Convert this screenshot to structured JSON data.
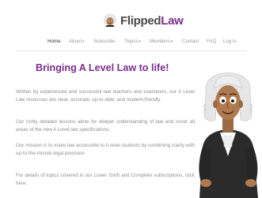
{
  "brand": {
    "name_part1": "Flipped",
    "name_part2": "Law",
    "icon": "lawyer-avatar-icon"
  },
  "nav": {
    "items": [
      {
        "label": "Home",
        "dropdown": false,
        "active": true
      },
      {
        "label": "About",
        "dropdown": true,
        "active": false
      },
      {
        "label": "Subscribe",
        "dropdown": false,
        "active": false
      },
      {
        "label": "Topics",
        "dropdown": true,
        "active": false
      },
      {
        "label": "Members",
        "dropdown": true,
        "active": false
      },
      {
        "label": "Contact",
        "dropdown": false,
        "active": false
      },
      {
        "label": "FAQ",
        "dropdown": false,
        "active": false
      },
      {
        "label": "Log in",
        "dropdown": false,
        "active": false
      }
    ],
    "caret": "▾"
  },
  "hero": {
    "headline": "Bringing A Level Law to life!",
    "paragraphs": [
      "Written by experienced and successful law teachers and examiners, our A Level Law resources are clear, accurate, up-to-date, and student-friendly.",
      "Our richly detailed lessons allow for deeper understanding of law and cover all areas of the new A Level law specifications.",
      "Our mission is to make law accessible to A level students by combining clarity with up-to-the-minute legal precision.",
      "For details of topics covered in our Lower Sixth and Complete subscriptions, click here."
    ]
  },
  "colors": {
    "brand_purple": "#7b2d8e",
    "text_gray": "#8e8e8e",
    "nav_gray": "#9a9a9a"
  }
}
